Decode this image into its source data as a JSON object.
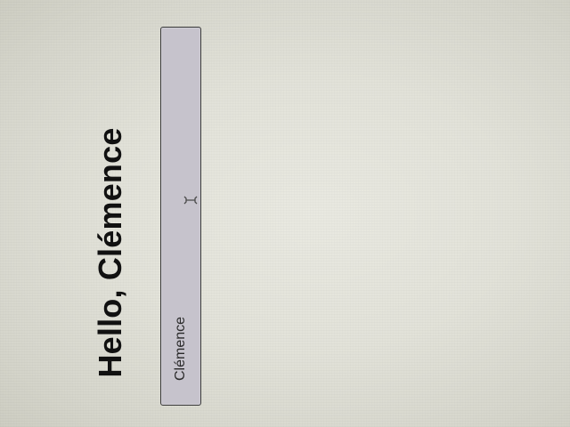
{
  "greeting": {
    "text": "Hello, Clémence"
  },
  "name_input": {
    "value": "Clémence"
  },
  "cursor": {
    "icon": "text-ibeam-cursor-icon"
  },
  "colors": {
    "background": "#e2e2d9",
    "input_fill": "#c6c3cc",
    "input_border": "#3a3a3a",
    "text": "#111111"
  }
}
